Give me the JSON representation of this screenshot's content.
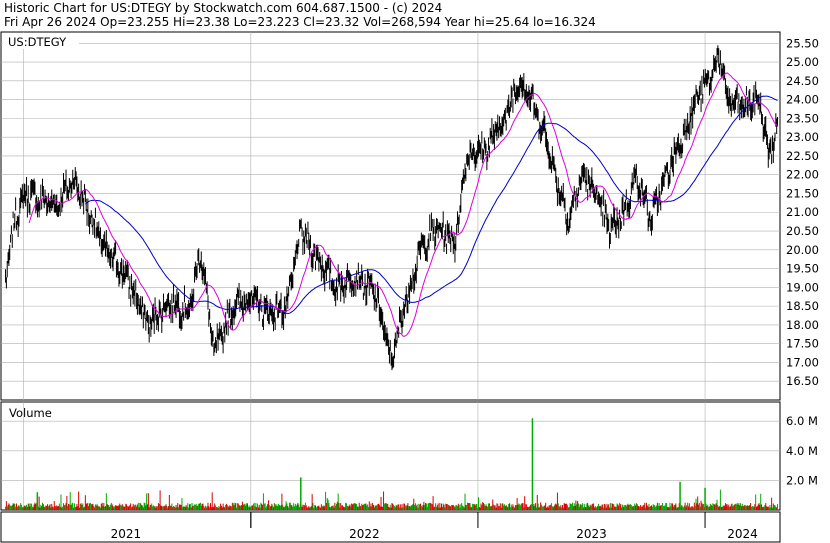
{
  "header": {
    "line1": "Historic Chart for US:DTEGY by Stockwatch.com 604.687.1500 - (c) 2024",
    "line2": "Fri Apr 26 2024   Op=23.255   Hi=23.38   Lo=23.223   Cl=23.32   Vol=268,594   Year hi=25.64   lo=16.324"
  },
  "price_panel": {
    "symbol_label": "US:DTEGY"
  },
  "volume_panel": {
    "label": "Volume"
  },
  "colors": {
    "candles": "#000000",
    "ma_short": "#dd00dd",
    "ma_long": "#0000cc",
    "vol_up": "#00aa00",
    "vol_down": "#dd0000",
    "grid": "#b0b0b0"
  },
  "chart_data": [
    {
      "type": "line",
      "title": "US:DTEGY",
      "y_ticks": [
        "16.50",
        "17.00",
        "17.50",
        "18.00",
        "18.50",
        "19.00",
        "19.50",
        "20.00",
        "20.50",
        "21.00",
        "21.50",
        "22.00",
        "22.50",
        "23.00",
        "23.50",
        "24.00",
        "24.50",
        "25.00",
        "25.50"
      ],
      "ylim": [
        16.0,
        25.8
      ],
      "x_ticks": [
        "2021",
        "2022",
        "2023",
        "2024"
      ],
      "grid": true,
      "price_anchors": [
        {
          "t": 2020.92,
          "v": 19.2
        },
        {
          "t": 2020.96,
          "v": 20.8
        },
        {
          "t": 2021.01,
          "v": 21.5
        },
        {
          "t": 2021.08,
          "v": 21.3
        },
        {
          "t": 2021.15,
          "v": 21.2
        },
        {
          "t": 2021.22,
          "v": 21.9
        },
        {
          "t": 2021.28,
          "v": 21.1
        },
        {
          "t": 2021.36,
          "v": 20.0
        },
        {
          "t": 2021.46,
          "v": 19.2
        },
        {
          "t": 2021.55,
          "v": 18.0
        },
        {
          "t": 2021.64,
          "v": 18.6
        },
        {
          "t": 2021.73,
          "v": 18.4
        },
        {
          "t": 2021.78,
          "v": 20.0
        },
        {
          "t": 2021.84,
          "v": 17.2
        },
        {
          "t": 2021.92,
          "v": 18.5
        },
        {
          "t": 2022.0,
          "v": 18.7
        },
        {
          "t": 2022.08,
          "v": 18.3
        },
        {
          "t": 2022.16,
          "v": 18.5
        },
        {
          "t": 2022.22,
          "v": 20.5
        },
        {
          "t": 2022.3,
          "v": 19.7
        },
        {
          "t": 2022.38,
          "v": 19.0
        },
        {
          "t": 2022.46,
          "v": 19.3
        },
        {
          "t": 2022.55,
          "v": 18.8
        },
        {
          "t": 2022.62,
          "v": 17.0
        },
        {
          "t": 2022.68,
          "v": 18.6
        },
        {
          "t": 2022.75,
          "v": 20.0
        },
        {
          "t": 2022.82,
          "v": 20.6
        },
        {
          "t": 2022.9,
          "v": 20.2
        },
        {
          "t": 2022.95,
          "v": 22.5
        },
        {
          "t": 2023.04,
          "v": 22.7
        },
        {
          "t": 2023.12,
          "v": 23.5
        },
        {
          "t": 2023.18,
          "v": 24.5
        },
        {
          "t": 2023.22,
          "v": 24.2
        },
        {
          "t": 2023.3,
          "v": 23.0
        },
        {
          "t": 2023.34,
          "v": 22.0
        },
        {
          "t": 2023.4,
          "v": 20.8
        },
        {
          "t": 2023.46,
          "v": 22.0
        },
        {
          "t": 2023.52,
          "v": 21.5
        },
        {
          "t": 2023.58,
          "v": 20.5
        },
        {
          "t": 2023.64,
          "v": 21.0
        },
        {
          "t": 2023.7,
          "v": 22.0
        },
        {
          "t": 2023.76,
          "v": 20.8
        },
        {
          "t": 2023.82,
          "v": 21.8
        },
        {
          "t": 2023.9,
          "v": 23.0
        },
        {
          "t": 2023.96,
          "v": 24.0
        },
        {
          "t": 2024.02,
          "v": 24.5
        },
        {
          "t": 2024.06,
          "v": 25.2
        },
        {
          "t": 2024.1,
          "v": 24.0
        },
        {
          "t": 2024.16,
          "v": 23.8
        },
        {
          "t": 2024.24,
          "v": 24.0
        },
        {
          "t": 2024.28,
          "v": 22.5
        },
        {
          "t": 2024.32,
          "v": 23.3
        }
      ]
    },
    {
      "type": "bar",
      "title": "Volume",
      "y_ticks": [
        "2.0 M",
        "4.0 M",
        "6.0 M"
      ],
      "ylim": [
        0,
        7.3
      ],
      "units": "M",
      "notable_spikes": [
        {
          "t": 2023.24,
          "v": 6.2
        },
        {
          "t": 2022.22,
          "v": 2.2
        },
        {
          "t": 2023.89,
          "v": 1.9
        },
        {
          "t": 2024.0,
          "v": 1.5
        },
        {
          "t": 2021.06,
          "v": 1.2
        }
      ]
    }
  ]
}
